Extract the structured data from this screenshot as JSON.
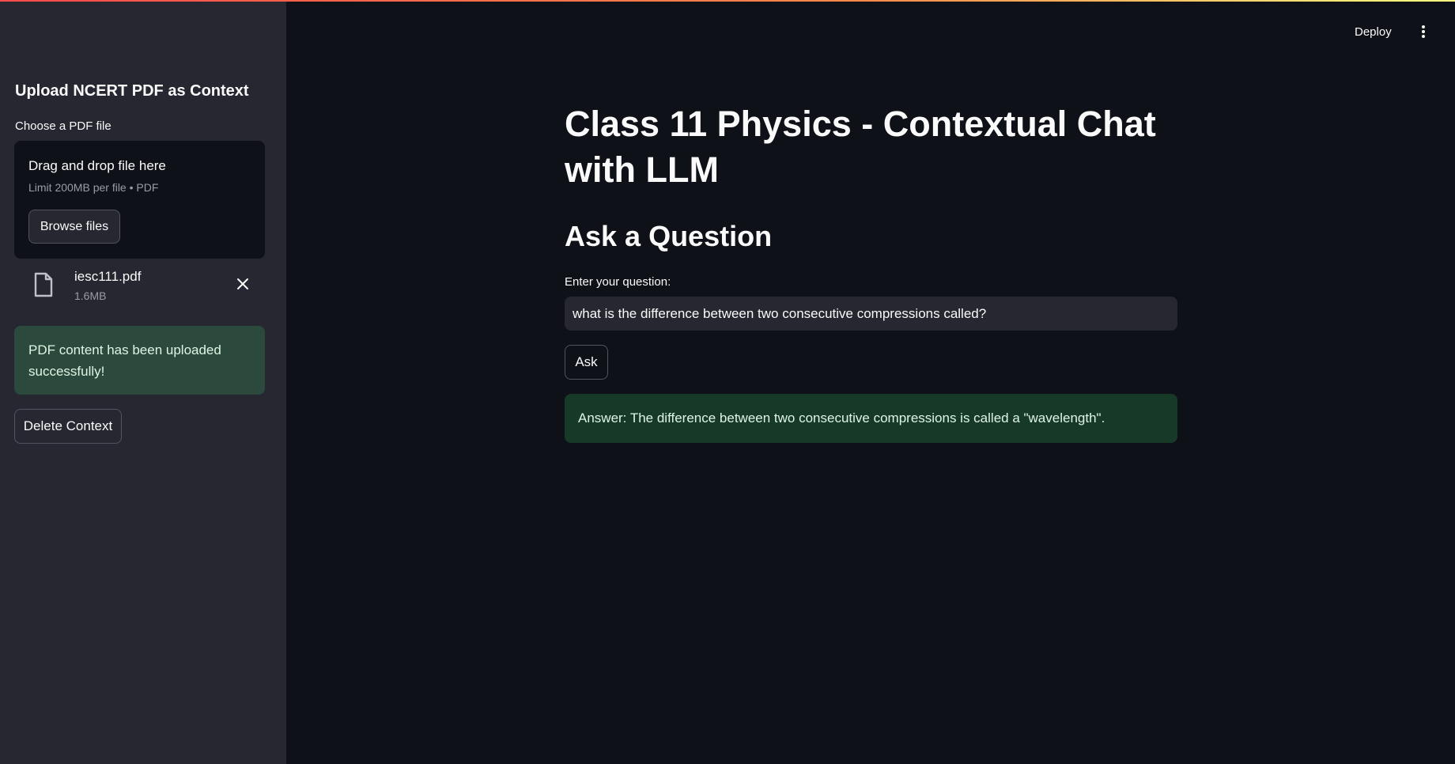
{
  "header": {
    "deploy_label": "Deploy",
    "menu_icon": "vertical-ellipsis-icon"
  },
  "sidebar": {
    "title": "Upload NCERT PDF as Context",
    "uploader": {
      "label": "Choose a PDF file",
      "dropzone_title": "Drag and drop file here",
      "limit_text": "Limit 200MB per file • PDF",
      "browse_label": "Browse files"
    },
    "file": {
      "icon": "file-icon",
      "name": "iesc111.pdf",
      "size": "1.6MB",
      "remove_icon": "close-icon"
    },
    "success_message": "PDF content has been uploaded successfully!",
    "delete_label": "Delete Context"
  },
  "main": {
    "title": "Class 11 Physics - Contextual Chat with LLM",
    "subheading": "Ask a Question",
    "question_label": "Enter your question:",
    "question_value": "what is the difference between two consecutive compressions called?",
    "ask_label": "Ask",
    "answer": "Answer: The difference between two consecutive compressions is called a \"wavelength\"."
  },
  "colors": {
    "background": "#0e1117",
    "sidebar": "#262730",
    "success_bg": "#2b4a3d",
    "answer_bg": "#173928",
    "accent_gradient_start": "#ff4b4b",
    "accent_gradient_end": "#fffd80"
  }
}
